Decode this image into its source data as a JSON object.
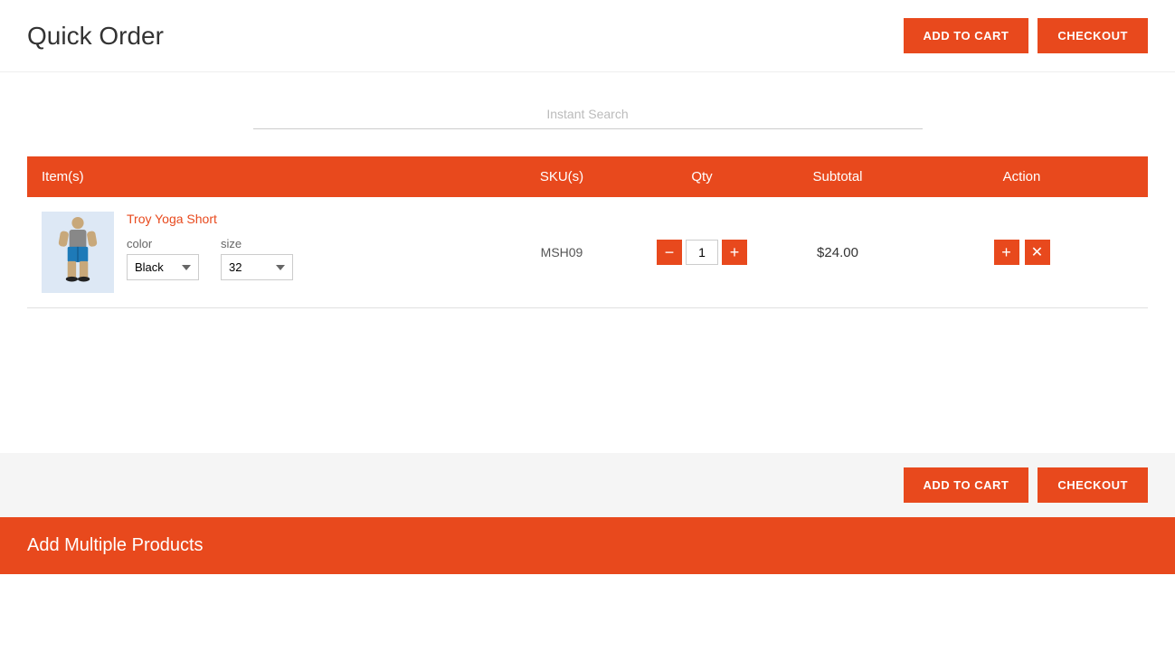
{
  "header": {
    "title": "Quick Order",
    "add_to_cart_label": "ADD TO CART",
    "checkout_label": "CHECKOUT"
  },
  "search": {
    "placeholder": "Instant Search"
  },
  "table": {
    "columns": {
      "items": "Item(s)",
      "skus": "SKU(s)",
      "qty": "Qty",
      "subtotal": "Subtotal",
      "action": "Action"
    },
    "rows": [
      {
        "product_name": "Troy Yoga Short",
        "sku": "MSH09",
        "color_label": "color",
        "color_value": "Black",
        "size_label": "size",
        "size_value": "32",
        "qty": "1",
        "subtotal": "$24.00"
      }
    ]
  },
  "footer": {
    "add_to_cart_label": "ADD TO CART",
    "checkout_label": "CHECKOUT"
  },
  "add_multiple": {
    "title": "Add Multiple Products"
  },
  "colors": {
    "orange": "#e8491d",
    "white": "#ffffff"
  }
}
